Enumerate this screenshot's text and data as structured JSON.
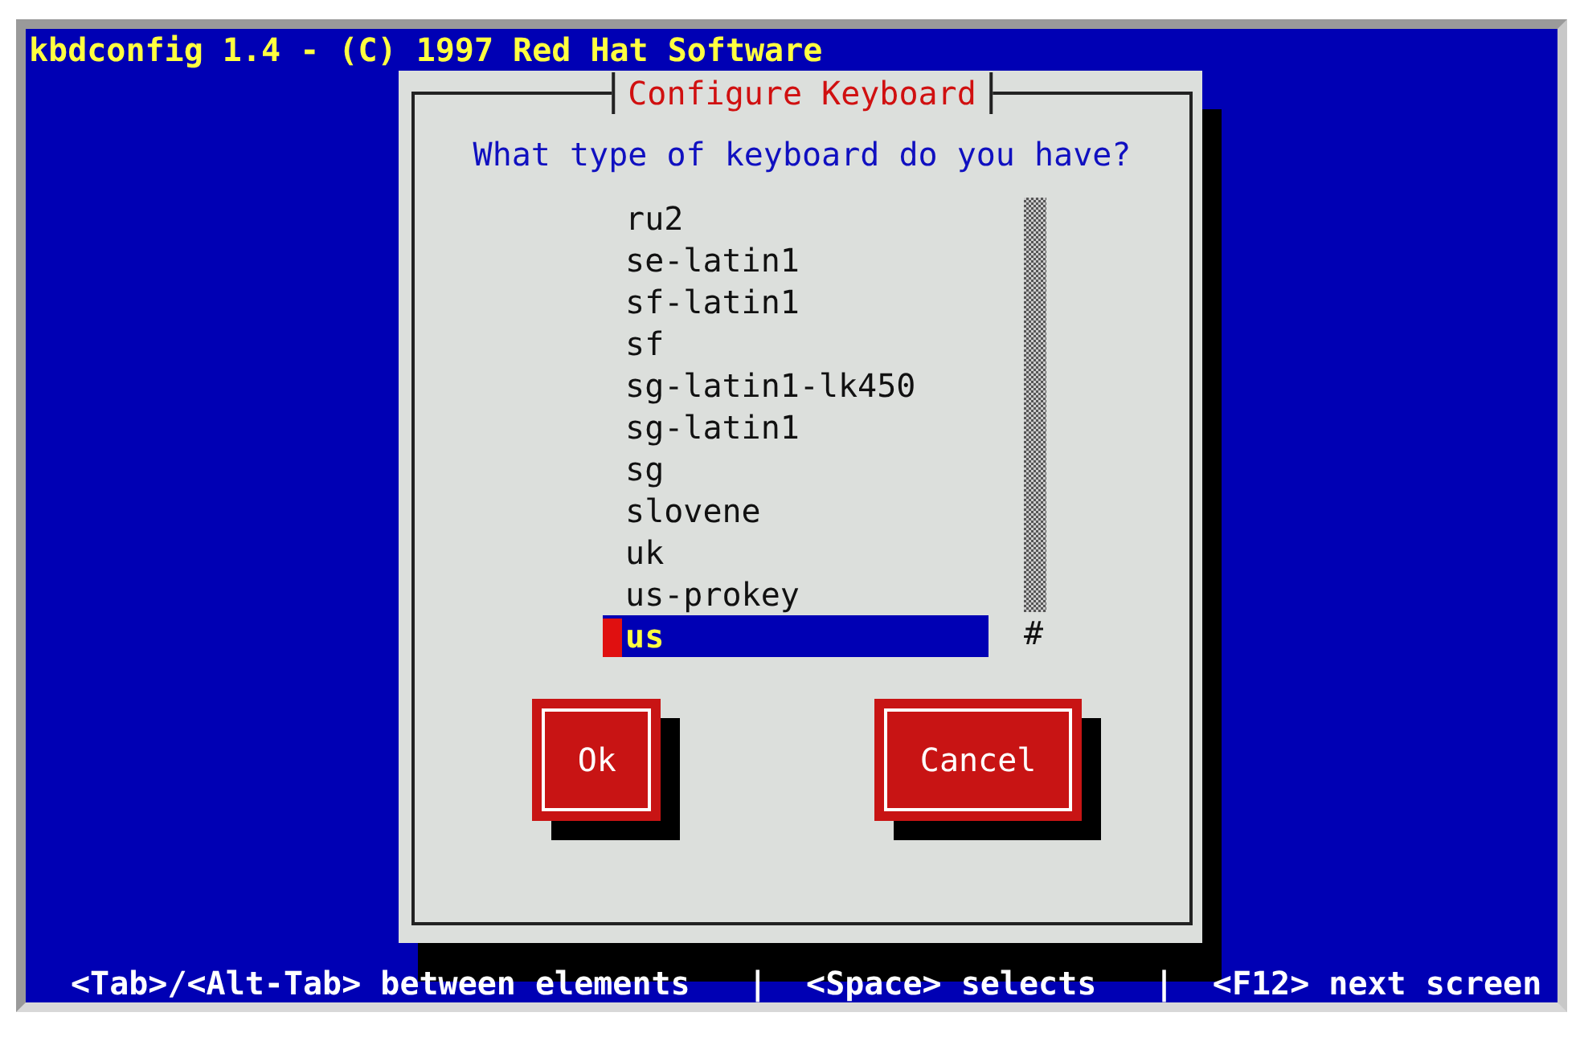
{
  "screen_title": "kbdconfig 1.4 - (C) 1997 Red Hat Software",
  "dialog": {
    "title": "Configure Keyboard",
    "prompt": "What type of keyboard do you have?",
    "list": {
      "items": [
        {
          "label": "ru2",
          "selected": false
        },
        {
          "label": "se-latin1",
          "selected": false
        },
        {
          "label": "sf-latin1",
          "selected": false
        },
        {
          "label": "sf",
          "selected": false
        },
        {
          "label": "sg-latin1-lk450",
          "selected": false
        },
        {
          "label": "sg-latin1",
          "selected": false
        },
        {
          "label": "sg",
          "selected": false
        },
        {
          "label": "slovene",
          "selected": false
        },
        {
          "label": "uk",
          "selected": false
        },
        {
          "label": "us-prokey",
          "selected": false
        },
        {
          "label": "us",
          "selected": true
        }
      ],
      "scroll_thumb": "#"
    },
    "buttons": [
      "Ok",
      "Cancel"
    ]
  },
  "status_bar": "<Tab>/<Alt-Tab> between elements   |  <Space> selects   |  <F12> next screen"
}
